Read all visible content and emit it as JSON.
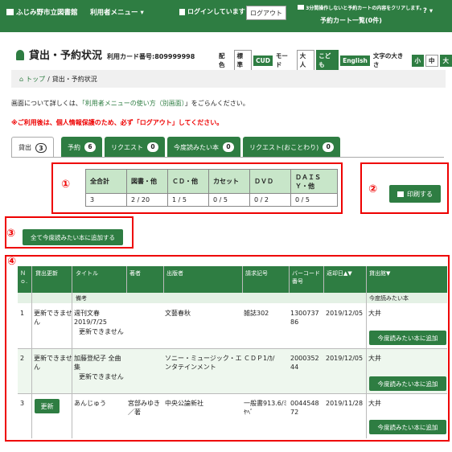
{
  "nav": {
    "library": "ふじみ野市立図書館",
    "menu": "利用者メニュー ▾",
    "login_status": "ログインしています",
    "logout": "ログアウト",
    "cart_note": "3分間操作しないと予約カートの内容をクリアします。",
    "cart_link": "予約カート一覧(0件)",
    "help": "? ▾"
  },
  "page": {
    "title": "貸出・予約状況",
    "card_label": "利用カード番号:809999998",
    "color_label": "配色",
    "color_std": "標準",
    "color_cud": "CUD",
    "mode_label": "モード",
    "mode_adult": "大人",
    "mode_kids": "こども",
    "mode_english": "English",
    "size_label": "文字の大きさ",
    "size_s": "小",
    "size_m": "中",
    "size_l": "大"
  },
  "breadcrumb": {
    "home": "トップ",
    "sep": "/",
    "current": "貸出・予約状況"
  },
  "info": {
    "prefix": "画面について詳しくは、",
    "link": "「利用者メニューの使い方（別画面）",
    "suffix": "」をごらんください。"
  },
  "warning": "※ご利用後は、個人情報保護のため、必ず「ログアウト」してください。",
  "tabs": [
    {
      "label": "貸出",
      "count": "3"
    },
    {
      "label": "予約",
      "count": "6"
    },
    {
      "label": "リクエスト",
      "count": "0"
    },
    {
      "label": "今度読みたい本",
      "count": "0"
    },
    {
      "label": "リクエスト(おことわり)",
      "count": "0"
    }
  ],
  "summary": {
    "headers": [
      "全合計",
      "図書・他",
      "ＣＤ・他",
      "カセット",
      "ＤＶＤ",
      "ＤＡＩＳＹ・他"
    ],
    "values": [
      "3",
      "2 / 20",
      "1 / 5",
      "0 / 5",
      "0 / 2",
      "0 / 5"
    ]
  },
  "markers": [
    "①",
    "②",
    "③",
    "④"
  ],
  "print_button": "印刷する",
  "add_all_button": "全て今度読みたい本に追加する",
  "list": {
    "headers": {
      "no": "Ｎｏ.",
      "renew": "貸出更新",
      "title": "タイトル",
      "author": "著者",
      "publisher": "出版者",
      "callno": "請求記号",
      "barcode": "バーコード番号",
      "due": "返却日▲▼",
      "branch": "貸出館▼",
      "remarks": "備考",
      "wantlist": "今度読みたい本"
    },
    "rows": [
      {
        "no": "1",
        "renew": "更新できません",
        "title": "週刊文春 2019/7/25",
        "author": "",
        "publisher": "文藝春秋",
        "callno": "雑誌302",
        "barcode": "1300737 86",
        "due": "2019/12/05",
        "branch": "大井",
        "remark": "更新できません",
        "add": "今度読みたい本に追加"
      },
      {
        "no": "2",
        "renew": "更新できません",
        "title": "加藤登紀子 全曲集",
        "author": "",
        "publisher": "ソニー・ミュージック・エンタテインメント",
        "callno": "ＣＤＰ1/ｶ/",
        "barcode": "2000352 44",
        "due": "2019/12/05",
        "branch": "大井",
        "remark": "更新できません",
        "add": "今度読みたい本に追加"
      },
      {
        "no": "3",
        "renew": "更新",
        "title": "あんじゅう",
        "author": "宮部みゆき／著",
        "publisher": "中央公論新社",
        "callno": "一般書913.6/ﾐﾔﾍﾞ",
        "barcode": "0044548 72",
        "due": "2019/11/28",
        "branch": "大井",
        "remark": "",
        "add": "今度読みたい本に追加"
      }
    ]
  }
}
